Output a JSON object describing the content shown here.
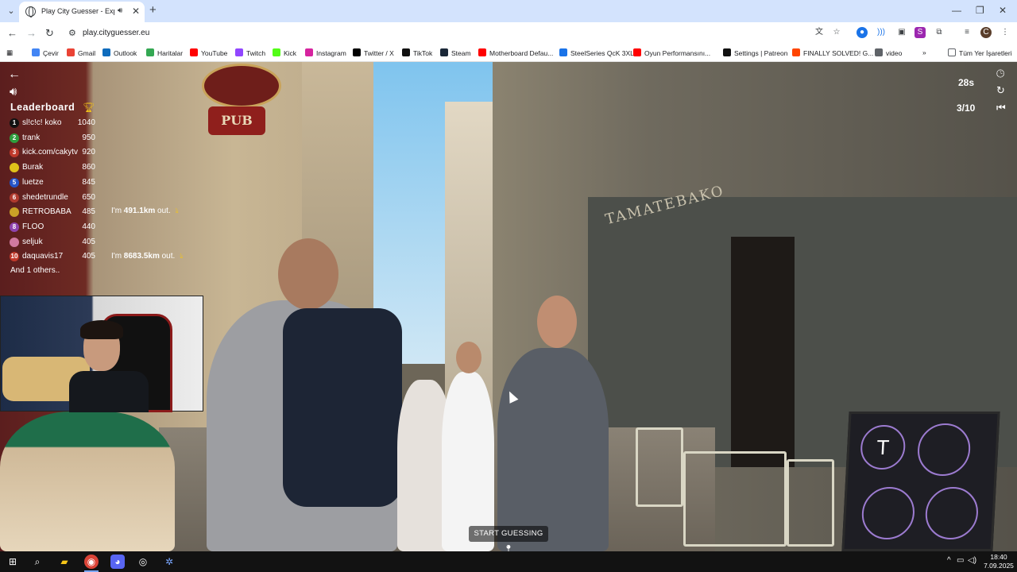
{
  "browser": {
    "tab_title": "Play City Guesser - Explore",
    "url": "play.cityguesser.eu",
    "bookmarks": [
      {
        "label": "Çevir",
        "icon": "translate-icon",
        "color": "#4285f4"
      },
      {
        "label": "Gmail",
        "icon": "gmail-icon",
        "color": "#ea4335"
      },
      {
        "label": "Outlook",
        "icon": "outlook-icon",
        "color": "#0f6cbd"
      },
      {
        "label": "Haritalar",
        "icon": "maps-icon",
        "color": "#34a853"
      },
      {
        "label": "YouTube",
        "icon": "youtube-icon",
        "color": "#ff0000"
      },
      {
        "label": "Twitch",
        "icon": "twitch-icon",
        "color": "#9146ff"
      },
      {
        "label": "Kick",
        "icon": "kick-icon",
        "color": "#53fc18"
      },
      {
        "label": "Instagram",
        "icon": "instagram-icon",
        "color": "#d6249f"
      },
      {
        "label": "Twitter / X",
        "icon": "x-icon",
        "color": "#000000"
      },
      {
        "label": "TikTok",
        "icon": "tiktok-icon",
        "color": "#111111"
      },
      {
        "label": "Steam",
        "icon": "steam-icon",
        "color": "#1b2838"
      },
      {
        "label": "Motherboard Defau...",
        "icon": "youtube-icon",
        "color": "#ff0000"
      },
      {
        "label": "SteelSeries QcK 3XL...",
        "icon": "steelseries-icon",
        "color": "#1a73e8"
      },
      {
        "label": "Oyun Performansını...",
        "icon": "youtube-icon",
        "color": "#ff0000"
      },
      {
        "label": "Settings | Patreon",
        "icon": "patreon-icon",
        "color": "#111111"
      },
      {
        "label": "FINALLY SOLVED! G...",
        "icon": "reddit-icon",
        "color": "#ff4500"
      },
      {
        "label": "video",
        "icon": "folder-icon",
        "color": "#5f6368"
      }
    ],
    "all_bookmarks": "Tüm Yer İşaretleri"
  },
  "game": {
    "leaderboard_title": "Leaderboard",
    "leaderboard": [
      {
        "rank": "1",
        "name": "sl!c!c! koko",
        "score": "1040",
        "color": "#111111"
      },
      {
        "rank": "2",
        "name": "trank",
        "score": "950",
        "color": "#2e9e3e"
      },
      {
        "rank": "3",
        "name": "kick.com/cakytv",
        "score": "920",
        "color": "#c0392b"
      },
      {
        "rank": "",
        "name": "Burak",
        "score": "860",
        "color": "#e0c21a"
      },
      {
        "rank": "5",
        "name": "luetze",
        "score": "845",
        "color": "#2554c7"
      },
      {
        "rank": "6",
        "name": "shedetrundle",
        "score": "650",
        "color": "#b03a2e"
      },
      {
        "rank": "",
        "name": "RETROBABA",
        "score": "485",
        "color": "#c9a227"
      },
      {
        "rank": "8",
        "name": "FLOO",
        "score": "440",
        "color": "#8e44ad"
      },
      {
        "rank": "",
        "name": "seljuk",
        "score": "405",
        "color": "#d07aa0"
      },
      {
        "rank": "10",
        "name": "daquavis17",
        "score": "405",
        "color": "#c0392b"
      }
    ],
    "and_others": "And 1 others..",
    "messages": [
      {
        "prefix": "I'm ",
        "distance": "491.1km",
        "suffix": " out."
      },
      {
        "prefix": "I'm ",
        "distance": "8683.5km",
        "suffix": " out."
      }
    ],
    "timer": "28s",
    "round": "3/10",
    "start_guessing": "START GUESSING",
    "shop_sign": "TAMATEBAKO",
    "pub_sign": "PUB",
    "menu_logo": "T"
  },
  "taskbar": {
    "time": "18:40",
    "date": "7.09.2025"
  }
}
